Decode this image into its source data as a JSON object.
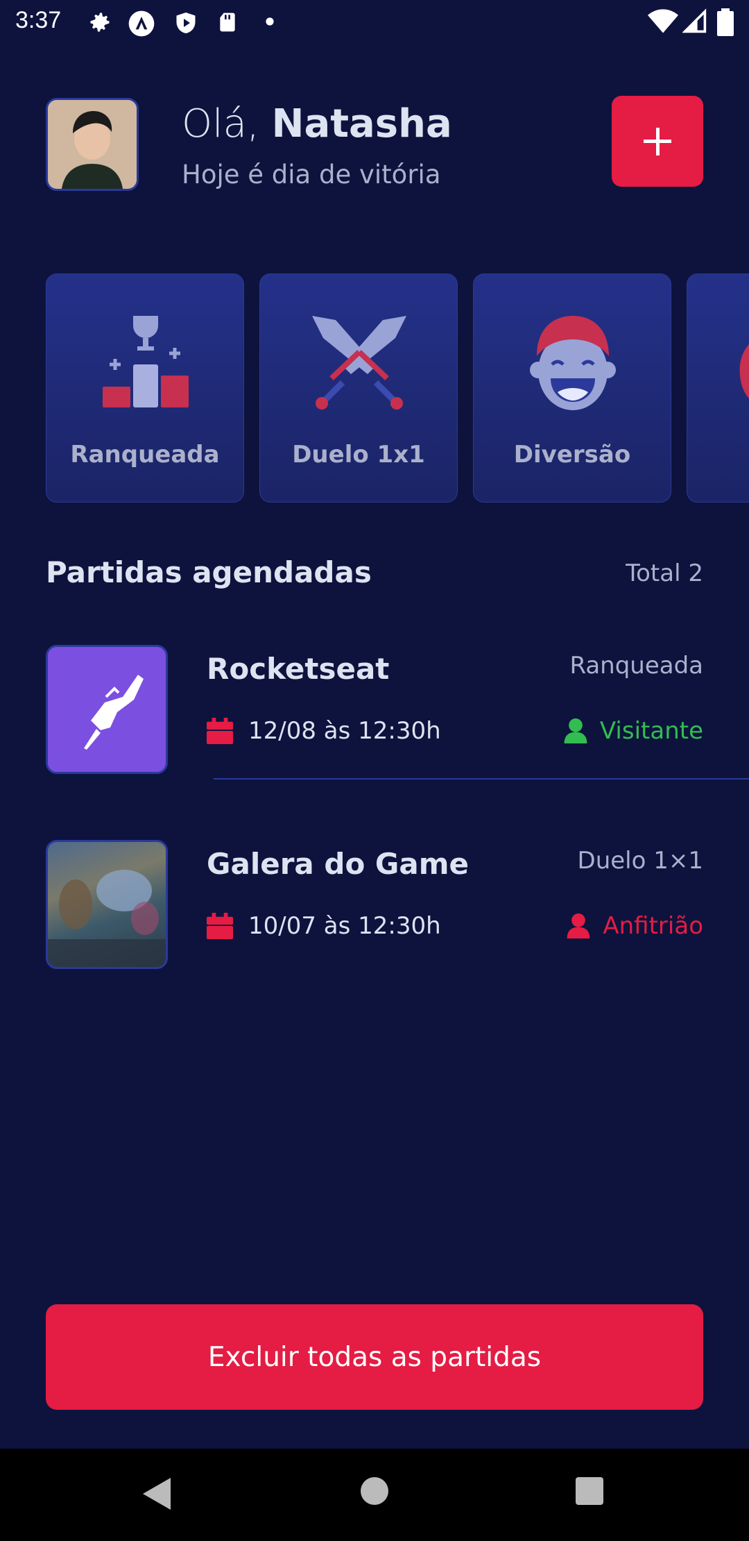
{
  "status_bar": {
    "time": "3:37"
  },
  "header": {
    "greeting_prefix": "Olá,",
    "user_name": "Natasha",
    "subtitle": "Hoje é dia de vitória"
  },
  "categories": [
    {
      "label": "Ranqueada",
      "icon": "ranking-icon"
    },
    {
      "label": "Duelo 1x1",
      "icon": "swords-icon"
    },
    {
      "label": "Diversão",
      "icon": "laughing-face-icon"
    },
    {
      "label": "",
      "icon": "partial-category-icon"
    }
  ],
  "section": {
    "title": "Partidas agendadas",
    "total": "Total 2"
  },
  "matches": [
    {
      "title": "Rocketseat",
      "category": "Ranqueada",
      "date": "12/08 às 12:30h",
      "role": "Visitante",
      "role_color": "#32bd50"
    },
    {
      "title": "Galera do Game",
      "category": "Duelo 1×1",
      "date": "10/07 às 12:30h",
      "role": "Anfitrião",
      "role_color": "#e51c44"
    }
  ],
  "footer": {
    "delete_label": "Excluir todas as partidas"
  },
  "colors": {
    "background": "#0d133d",
    "accent": "#e51c44",
    "card": "#243189",
    "text": "#dde3f0",
    "muted": "#abb1cc",
    "success": "#32bd50"
  }
}
